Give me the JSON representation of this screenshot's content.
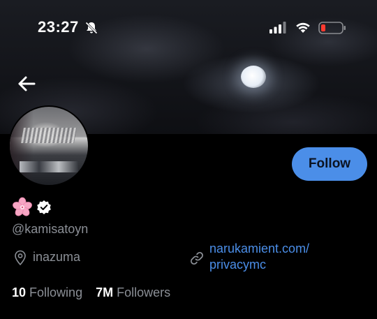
{
  "status_bar": {
    "time": "23:27",
    "icons": [
      "bell-slash-icon",
      "cellular-signal-icon",
      "wifi-icon",
      "battery-low-icon"
    ]
  },
  "header": {
    "back_icon": "arrow-left-icon"
  },
  "profile": {
    "display_name_emoji": "🌸",
    "verified_icon": "verified-badge-icon",
    "handle": "@kamisatoyn",
    "location": "inazuma",
    "link_line1": "narukamient.com/",
    "link_line2": "privacymc",
    "follow_label": "Follow",
    "following_count": "10",
    "following_label": "Following",
    "followers_count": "7M",
    "followers_label": "Followers"
  },
  "colors": {
    "accent": "#4b8ee8",
    "muted_text": "#8b8f96",
    "background": "#000000",
    "battery_low": "#ff3b30"
  }
}
